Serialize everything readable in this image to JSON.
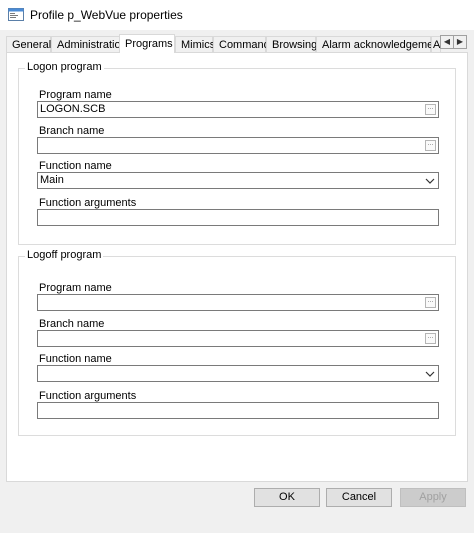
{
  "window": {
    "title": "Profile p_WebVue properties",
    "icon": "properties-window-icon"
  },
  "tabs": [
    {
      "label": "General"
    },
    {
      "label": "Administration"
    },
    {
      "label": "Programs",
      "active": true
    },
    {
      "label": "Mimics"
    },
    {
      "label": "Command"
    },
    {
      "label": "Browsing"
    },
    {
      "label": "Alarm acknowledgement"
    },
    {
      "label": "A"
    }
  ],
  "tab_scroll": {
    "left": "◀",
    "right": "▶"
  },
  "logon": {
    "legend": "Logon program",
    "program_name_label": "Program name",
    "program_name_value": "LOGON.SCB",
    "branch_name_label": "Branch name",
    "branch_name_value": "",
    "function_name_label": "Function name",
    "function_name_value": "Main",
    "function_args_label": "Function arguments",
    "function_args_value": ""
  },
  "logoff": {
    "legend": "Logoff program",
    "program_name_label": "Program name",
    "program_name_value": "",
    "branch_name_label": "Branch name",
    "branch_name_value": "",
    "function_name_label": "Function name",
    "function_name_value": "",
    "function_args_label": "Function arguments",
    "function_args_value": ""
  },
  "buttons": {
    "ok": "OK",
    "cancel": "Cancel",
    "apply": "Apply"
  },
  "ellipsis_glyph": "...",
  "colors": {
    "window_bg": "#f0f0f0",
    "panel_bg": "#ffffff",
    "border": "#7a7a7a",
    "disabled_text": "#a0a0a0"
  }
}
